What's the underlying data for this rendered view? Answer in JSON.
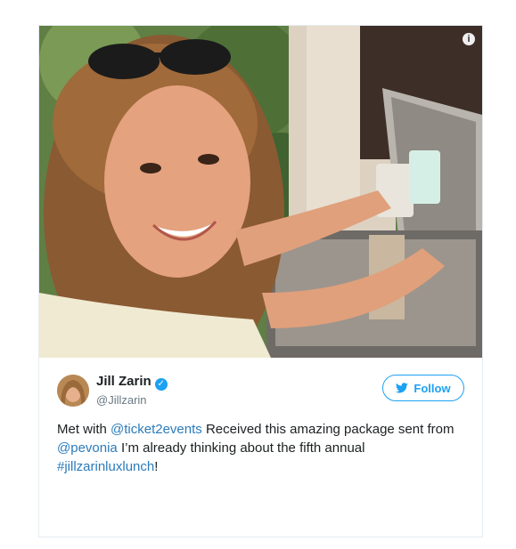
{
  "tweet": {
    "author": {
      "display_name": "Jill Zarin",
      "handle": "@Jillzarin",
      "verified": true
    },
    "follow_label": "Follow",
    "text": {
      "part1": "Met with ",
      "mention1": "@ticket2events",
      "part2": " Received this amazing package sent from ",
      "mention2": "@pevonia",
      "part3": " I’m already thinking about the fifth annual ",
      "hashtag": "#jillzarinluxlunch",
      "part4": "!"
    },
    "media_info_glyph": "i"
  },
  "icons": [
    "info-icon",
    "verified-badge-icon",
    "twitter-bird-icon"
  ],
  "colors": {
    "accent": "#1da1f2",
    "link": "#2b7bb9",
    "muted_text": "#697882",
    "border": "#e6ecf0"
  }
}
